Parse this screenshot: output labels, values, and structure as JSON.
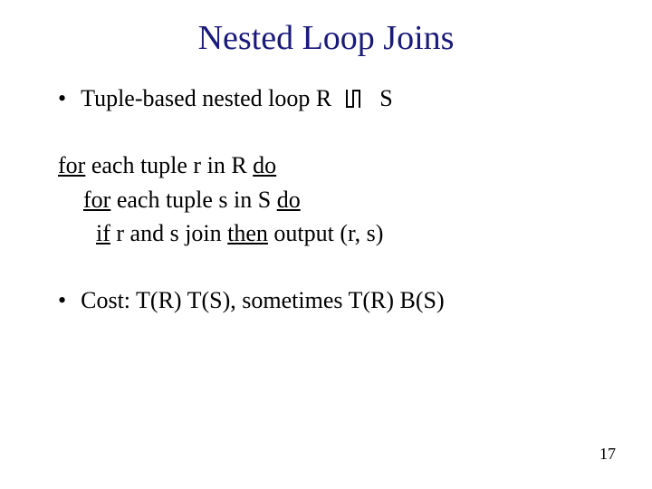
{
  "title": "Nested Loop Joins",
  "bullet1": {
    "prefix": "Tuple-based nested loop R",
    "suffix": "S"
  },
  "code": {
    "line1_u1": "for",
    "line1_mid": " each tuple r in R ",
    "line1_u2": "do",
    "line2_u1": "for",
    "line2_mid": " each tuple s in S ",
    "line2_u2": "do",
    "line3_u1": "if",
    "line3_mid1": " r and s join ",
    "line3_u2": "then",
    "line3_mid2": " output (r, s)"
  },
  "cost": "Cost: T(R) T(S),  sometimes T(R) B(S)",
  "page_number": "17"
}
